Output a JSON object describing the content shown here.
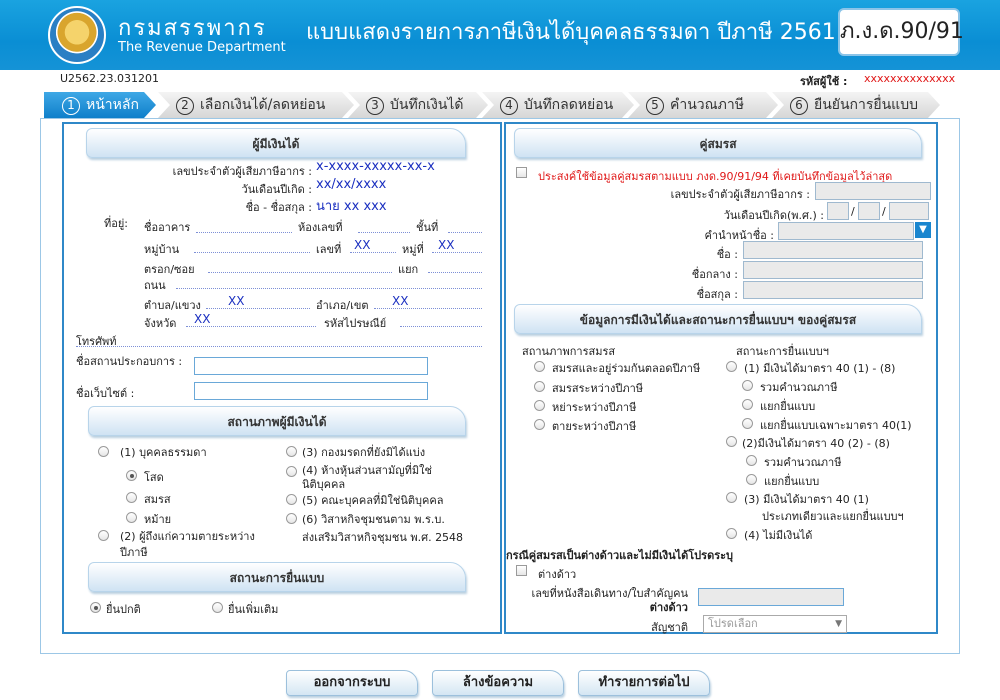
{
  "header": {
    "org_th": "กรมสรรพากร",
    "org_en": "The Revenue Department",
    "title": "แบบแสดงรายการภาษีเงินได้บุคคลธรรมดา ปีภาษี 2561",
    "form_code": "ภ.ง.ด.90/91"
  },
  "meta": {
    "ref_code": "U2562.23.031201",
    "user_label": "รหัสผู้ใช้ :",
    "user_value": "xxxxxxxxxxxxxx"
  },
  "steps": [
    {
      "num": "1",
      "label": "หน้าหลัก"
    },
    {
      "num": "2",
      "label": "เลือกเงินได้/ลดหย่อน"
    },
    {
      "num": "3",
      "label": "บันทึกเงินได้"
    },
    {
      "num": "4",
      "label": "บันทึกลดหย่อน"
    },
    {
      "num": "5",
      "label": "คำนวณภาษี"
    },
    {
      "num": "6",
      "label": "ยืนยันการยื่นแบบ"
    }
  ],
  "taxpayer": {
    "title": "ผู้มีเงินได้",
    "tin_label": "เลขประจำตัวผู้เสียภาษีอากร :",
    "tin_value": "x-xxxx-xxxxx-xx-x",
    "dob_label": "วันเดือนปีเกิด :",
    "dob_value": "xx/xx/xxxx",
    "name_label": "ชื่อ - ชื่อสกุล :",
    "name_value": "นาย xx xxx",
    "address_label": "ที่อยู่:",
    "building_label": "ชื่ออาคาร",
    "room_label": "ห้องเลขที่",
    "floor_label": "ชั้นที่",
    "village_label": "หมู่บ้าน",
    "house_no_label": "เลขที่",
    "house_no_value": "XX",
    "moo_label": "หมู่ที่",
    "moo_value": "XX",
    "soi_label": "ตรอก/ซอย",
    "yaek_label": "แยก",
    "road_label": "ถนน",
    "subdistrict_label": "ตำบล/แขวง",
    "subdistrict_value": "XX",
    "district_label": "อำเภอ/เขต",
    "district_value": "XX",
    "province_label": "จังหวัด",
    "province_value": "XX",
    "postcode_label": "รหัสไปรษณีย์",
    "phone_label": "โทรศัพท์",
    "business_label": "ชื่อสถานประกอบการ :",
    "website_label": "ชื่อเว็บไซต์ :"
  },
  "status": {
    "title": "สถานภาพผู้มีเงินได้",
    "opt1": "(1) บุคคลธรรมดา",
    "single": "โสด",
    "married": "สมรส",
    "divorced": "หม้าย",
    "opt2_line1": "(2) ผู้ถึงแก่ความตายระหว่าง",
    "opt2_line2": "ปีภาษี",
    "opt3": "(3) กองมรดกที่ยังมิได้แบ่ง",
    "opt4_line1": "(4) ห้างหุ้นส่วนสามัญที่มิใช่",
    "opt4_line2": "นิติบุคคล",
    "opt5": "(5) คณะบุคคลที่มิใช่นิติบุคคล",
    "opt6_line1": "(6) วิสาหกิจชุมชนตาม พ.ร.บ.",
    "opt6_line2": "ส่งเสริมวิสาหกิจชุมชน พ.ศ. 2548"
  },
  "filing": {
    "title": "สถานะการยื่นแบบ",
    "normal": "ยื่นปกติ",
    "additional": "ยื่นเพิ่มเติม"
  },
  "spouse": {
    "title": "คู่สมรส",
    "use_prev": "ประสงค์ใช้ข้อมูลคู่สมรสตามแบบ ภงด.90/91/94 ที่เคยบันทึกข้อมูลไว้ล่าสุด",
    "tin_label": "เลขประจำตัวผู้เสียภาษีอากร :",
    "dob_label": "วันเดือนปีเกิด(พ.ศ.) :",
    "prefix_label": "คำนำหน้าชื่อ :",
    "first_label": "ชื่อ :",
    "middle_label": "ชื่อกลาง :",
    "last_label": "ชื่อสกุล :",
    "sel_arrow": "▼"
  },
  "spouse_income": {
    "title": "ข้อมูลการมีเงินได้และสถานะการยื่นแบบฯ ของคู่สมรส",
    "marital_head": "สถานภาพการสมรส",
    "m1": "สมรสและอยู่ร่วมกันตลอดปีภาษี",
    "m2": "สมรสระหว่างปีภาษี",
    "m3": "หย่าระหว่างปีภาษี",
    "m4": "ตายระหว่างปีภาษี",
    "filing_head": "สถานะการยื่นแบบฯ",
    "f1": "(1) มีเงินได้มาตรา 40 (1) - (8)",
    "f1a": "รวมคำนวณภาษี",
    "f1b": "แยกยื่นแบบ",
    "f1c": "แยกยื่นแบบเฉพาะมาตรา 40(1)",
    "f2": "(2)มีเงินได้มาตรา 40 (2) - (8)",
    "f2a": "รวมคำนวณภาษี",
    "f2b": "แยกยื่นแบบ",
    "f3_line1": "(3) มีเงินได้มาตรา 40 (1)",
    "f3_line2": "ประเภทเดียวและแยกยื่นแบบฯ",
    "f4": "(4) ไม่มีเงินได้"
  },
  "foreign": {
    "title": "กรณีคู่สมรสเป็นต่างด้าวและไม่มีเงินได้โปรดระบุ",
    "alien": "ต่างด้าว",
    "passport_line1": "เลขที่หนังสือเดินทาง/ใบสำคัญคน",
    "passport_line2": "ต่างด้าว",
    "nationality_label": "สัญชาติ",
    "nationality_value": "โปรดเลือก",
    "nationality_arrow": "▼"
  },
  "actions": {
    "exit": "ออกจากระบบ",
    "clear": "ล้างข้อความ",
    "next": "ทำรายการต่อไป"
  },
  "colors": {
    "header_blue": "#0a8ed4",
    "step_active": "#1a86cf",
    "panel_border": "#2f88c8",
    "value_blue": "#1a2fc0",
    "alert_red": "#e01818"
  }
}
